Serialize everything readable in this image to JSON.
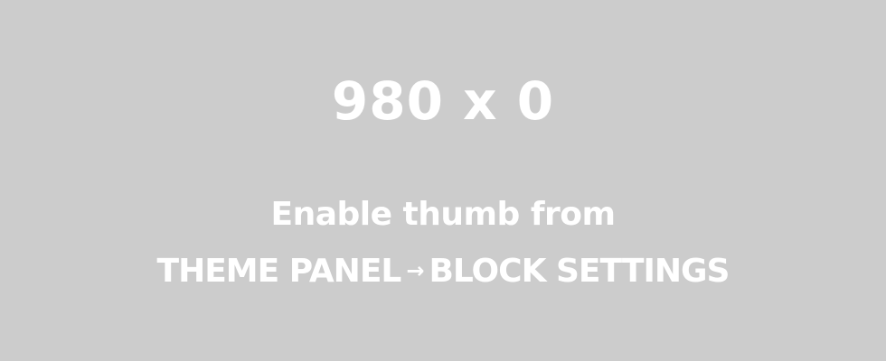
{
  "placeholder": {
    "dimensions": "980 x 0",
    "line1": "Enable thumb from",
    "path_start": "THEME PANEL",
    "arrow_icon": "arrow-right-icon",
    "arrow_glyph": "→",
    "path_end": "BLOCK SETTINGS"
  },
  "colors": {
    "background": "#cccccc",
    "text": "#ffffff"
  }
}
